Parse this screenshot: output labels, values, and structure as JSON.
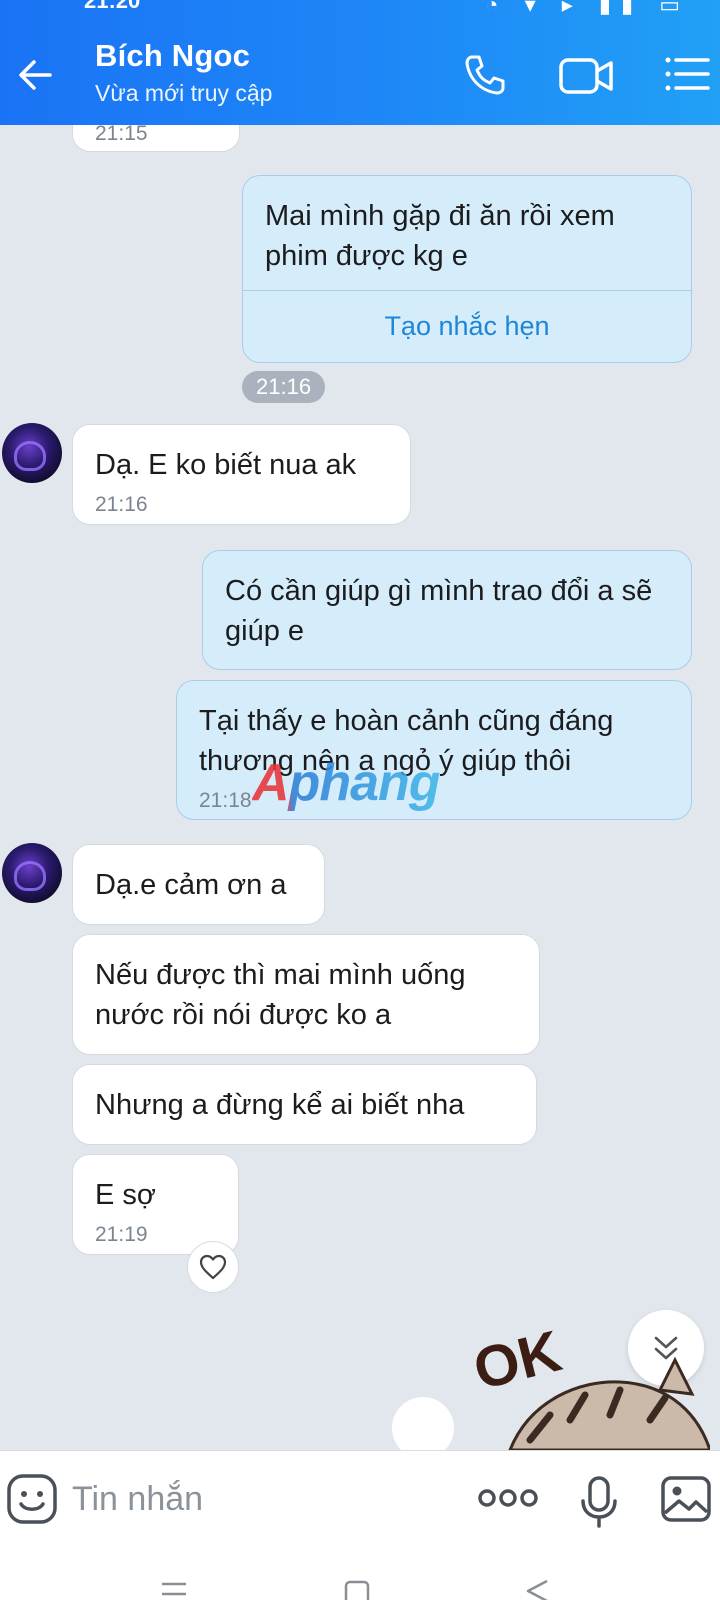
{
  "status_bar": {
    "time": "21:20"
  },
  "header": {
    "contact_name": "Bích Ngoc",
    "contact_status": "Vừa mới truy cập"
  },
  "messages": [
    {
      "dir": "in",
      "time": "21:15"
    },
    {
      "dir": "out",
      "text": "Mai mình gặp đi ăn rồi xem phim được kg e",
      "action": "Tạo nhắc hẹn"
    },
    {
      "dir": "divider",
      "time": "21:16"
    },
    {
      "dir": "in",
      "text": "Dạ. E ko biết nua ak",
      "time": "21:16"
    },
    {
      "dir": "out",
      "text": "Có cần giúp gì mình trao đổi a sẽ giúp e"
    },
    {
      "dir": "out",
      "text": "Tại thấy e hoàn cảnh cũng đáng thương nên a ngỏ ý giúp thôi",
      "time": "21:18"
    },
    {
      "dir": "in",
      "text": "Dạ.e cảm ơn a"
    },
    {
      "dir": "in",
      "text": "Nếu được thì mai mình uống nước rồi nói được ko a"
    },
    {
      "dir": "in",
      "text": "Nhưng a đừng kể ai biết nha"
    },
    {
      "dir": "in",
      "text": "E sợ",
      "time": "21:19"
    }
  ],
  "watermark": "Aphang",
  "sticker_text": "OK",
  "composer": {
    "placeholder": "Tin nhắn"
  },
  "colors": {
    "header_blue": "#1a73f5",
    "out_bubble": "#d5edfb",
    "link_blue": "#1f86d6",
    "chat_bg": "#e2e7ee"
  }
}
